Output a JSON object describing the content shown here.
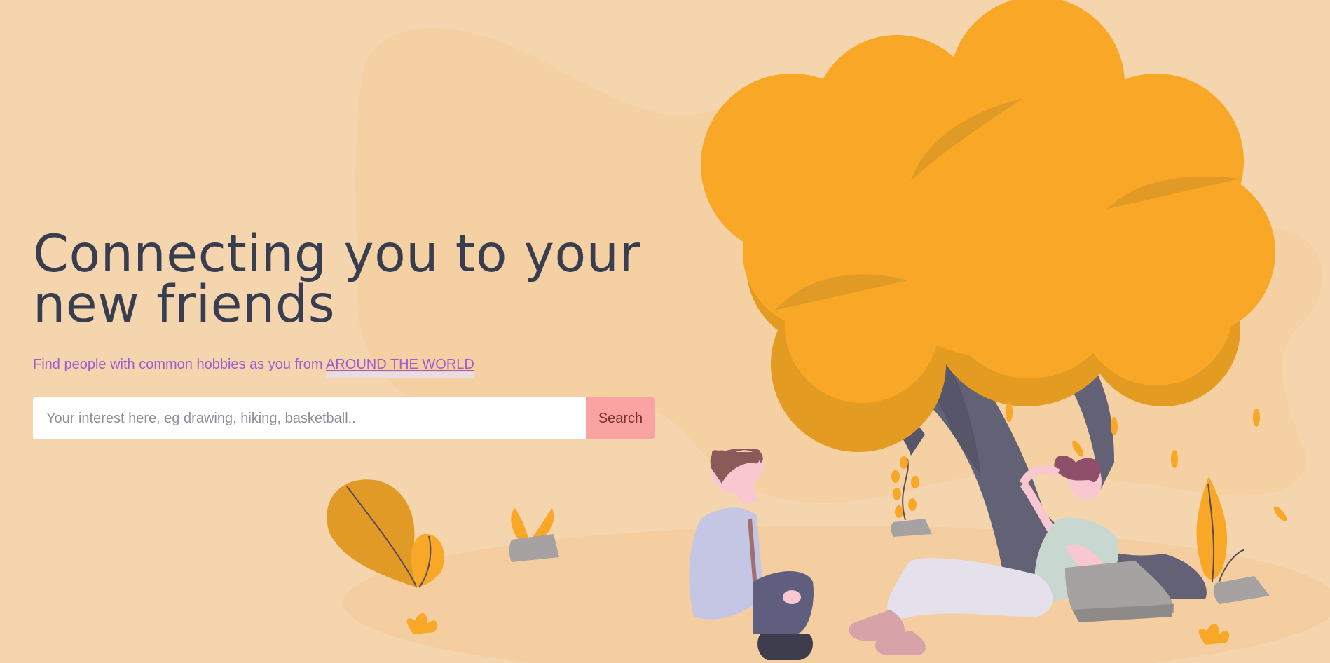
{
  "hero": {
    "headline": "Connecting you to your new friends",
    "subtitle_prefix": "Find people with common hobbies as you from ",
    "subtitle_highlight": "AROUND THE WORLD"
  },
  "search": {
    "placeholder": "Your interest here, eg drawing, hiking, basketball..",
    "value": "",
    "button_label": "Search"
  },
  "colors": {
    "background": "#f5d5ae",
    "headline": "#383d4f",
    "accent_text": "#9f5bd0",
    "button": "#f9a3a3",
    "tree_foliage": "#f8a727",
    "tree_trunk": "#636175"
  },
  "illustration": {
    "name": "two-friends-under-tree-illustration"
  }
}
